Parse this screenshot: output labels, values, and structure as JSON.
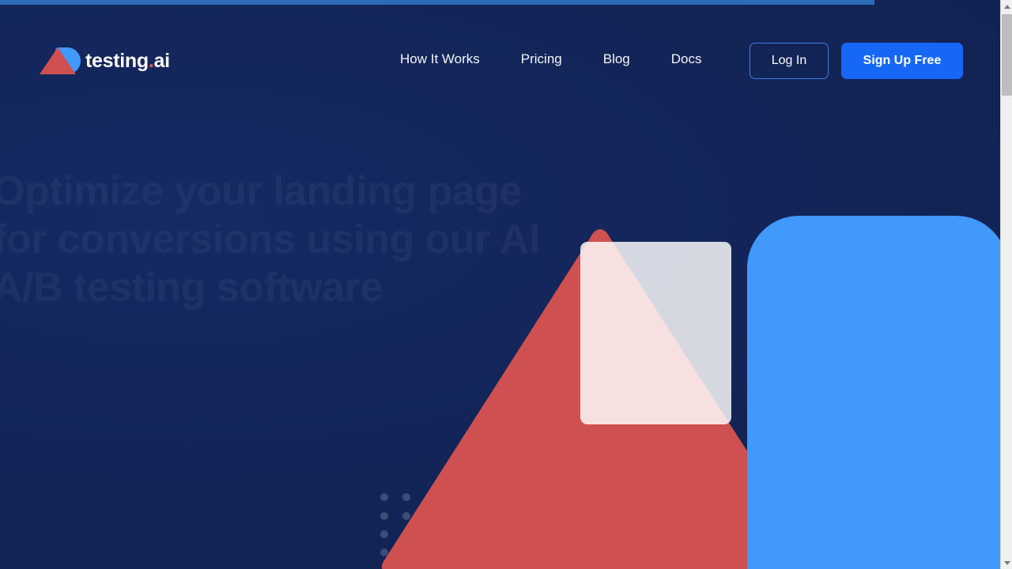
{
  "browser": {
    "scrollbar": {
      "up_arrow_icon": "scroll-up-arrow-icon",
      "down_arrow_icon": "scroll-down-arrow-icon",
      "thumb_position_pct": 2
    }
  },
  "page": {
    "background_color": "#11204d",
    "loading_progress_pct": 87
  },
  "header": {
    "logo": {
      "mark_icon": "ab-logo-icon",
      "triangle_color": "#cf5050",
      "b_shape_color": "#4099fb",
      "text_primary": "testing",
      "text_dot": ".",
      "text_suffix": "ai",
      "full_text": "testing.ai"
    },
    "nav": [
      {
        "label": "How It Works"
      },
      {
        "label": "Pricing"
      },
      {
        "label": "Blog"
      },
      {
        "label": "Docs"
      }
    ],
    "login_label": "Log In",
    "signup_label": "Sign Up Free",
    "login_border_color": "#3f7fe0",
    "signup_background_color": "#1667f5"
  },
  "hero": {
    "heading": "Optimize your landing page for conversions using our AI A/B testing software"
  },
  "decor": {
    "triangle_color": "#cf5050",
    "blue_panel_color": "#4099fb",
    "card_color": "rgba(255,255,255,0.825)",
    "dot_color": "#3a4d77",
    "dot_rows": 4,
    "dot_cols": 2
  }
}
